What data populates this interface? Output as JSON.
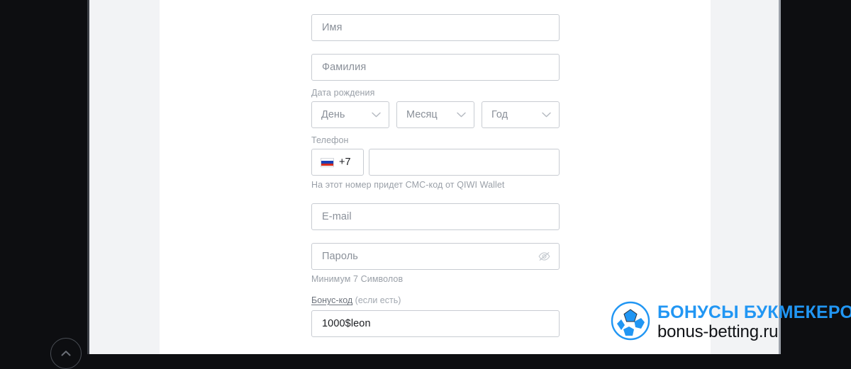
{
  "page": {
    "background_dark": "#0d0e11",
    "background_panel": "#f2f3f5",
    "background_content": "#ffffff"
  },
  "scroll_top_button": {
    "icon": "chevron-up-icon"
  },
  "form": {
    "first_name": {
      "placeholder": "Имя",
      "value": ""
    },
    "last_name": {
      "placeholder": "Фамилия",
      "value": ""
    },
    "birth_date": {
      "label": "Дата рождения",
      "day": {
        "placeholder": "День",
        "icon": "chevron-down-icon"
      },
      "month": {
        "placeholder": "Месяц",
        "icon": "chevron-down-icon"
      },
      "year": {
        "placeholder": "Год",
        "icon": "chevron-down-icon"
      }
    },
    "phone": {
      "label": "Телефон",
      "country_flag": "russia-flag-icon",
      "country_code": "+7",
      "value": "",
      "helper": "На этот номер придет СМС-код от QIWI Wallet"
    },
    "email": {
      "placeholder": "E-mail",
      "value": ""
    },
    "password": {
      "placeholder": "Пароль",
      "value": "",
      "toggle_icon": "eye-off-icon",
      "helper": "Минимум 7 Символов"
    },
    "bonus_code": {
      "label": "Бонус-код",
      "label_note": "(если есть)",
      "value": "1000$leon"
    }
  },
  "watermark": {
    "icon": "soccer-ball-icon",
    "title": "БОНУСЫ БУКМЕКЕРОВ",
    "subtitle": "bonus-betting.ru",
    "title_color": "#2196f3",
    "subtitle_color": "#111317"
  }
}
